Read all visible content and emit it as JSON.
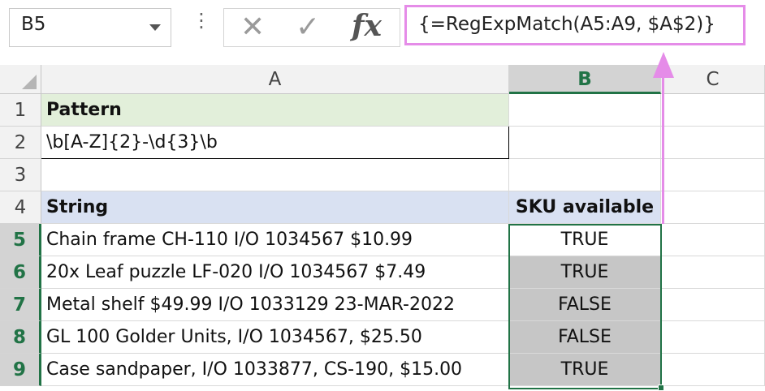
{
  "name_box": {
    "value": "B5"
  },
  "formula_bar": {
    "cancel_glyph": "✕",
    "enter_glyph": "✓",
    "fx_label": "fx",
    "formula": "{=RegExpMatch(A5:A9, $A$2)}"
  },
  "columns": [
    {
      "label": "A",
      "selected": false
    },
    {
      "label": "B",
      "selected": true
    },
    {
      "label": "C",
      "selected": false
    }
  ],
  "rows": [
    {
      "num": "1",
      "selected": false,
      "a": "Pattern",
      "b": ""
    },
    {
      "num": "2",
      "selected": false,
      "a": "\\b[A-Z]{2}-\\d{3}\\b",
      "b": ""
    },
    {
      "num": "3",
      "selected": false,
      "a": "",
      "b": ""
    },
    {
      "num": "4",
      "selected": false,
      "a": "String",
      "b": "SKU available"
    },
    {
      "num": "5",
      "selected": true,
      "a": "Chain frame CH-110 I/O 1034567 $10.99",
      "b": "TRUE"
    },
    {
      "num": "6",
      "selected": true,
      "a": "20x Leaf puzzle LF-020 I/O 1034567 $7.49",
      "b": "TRUE"
    },
    {
      "num": "7",
      "selected": true,
      "a": "Metal shelf $49.99  I/O 1033129 23-MAR-2022",
      "b": "FALSE"
    },
    {
      "num": "8",
      "selected": true,
      "a": "GL 100 Golder Units, I/O 1034567, $25.50",
      "b": "FALSE"
    },
    {
      "num": "9",
      "selected": true,
      "a": "Case sandpaper, I/O 1033877, CS-190, $15.00",
      "b": "TRUE"
    }
  ],
  "colors": {
    "accent_green": "#217346",
    "highlight_pink": "#e58ce8",
    "pattern_header_bg": "#e2efda",
    "string_header_bg": "#d9e1f2"
  }
}
